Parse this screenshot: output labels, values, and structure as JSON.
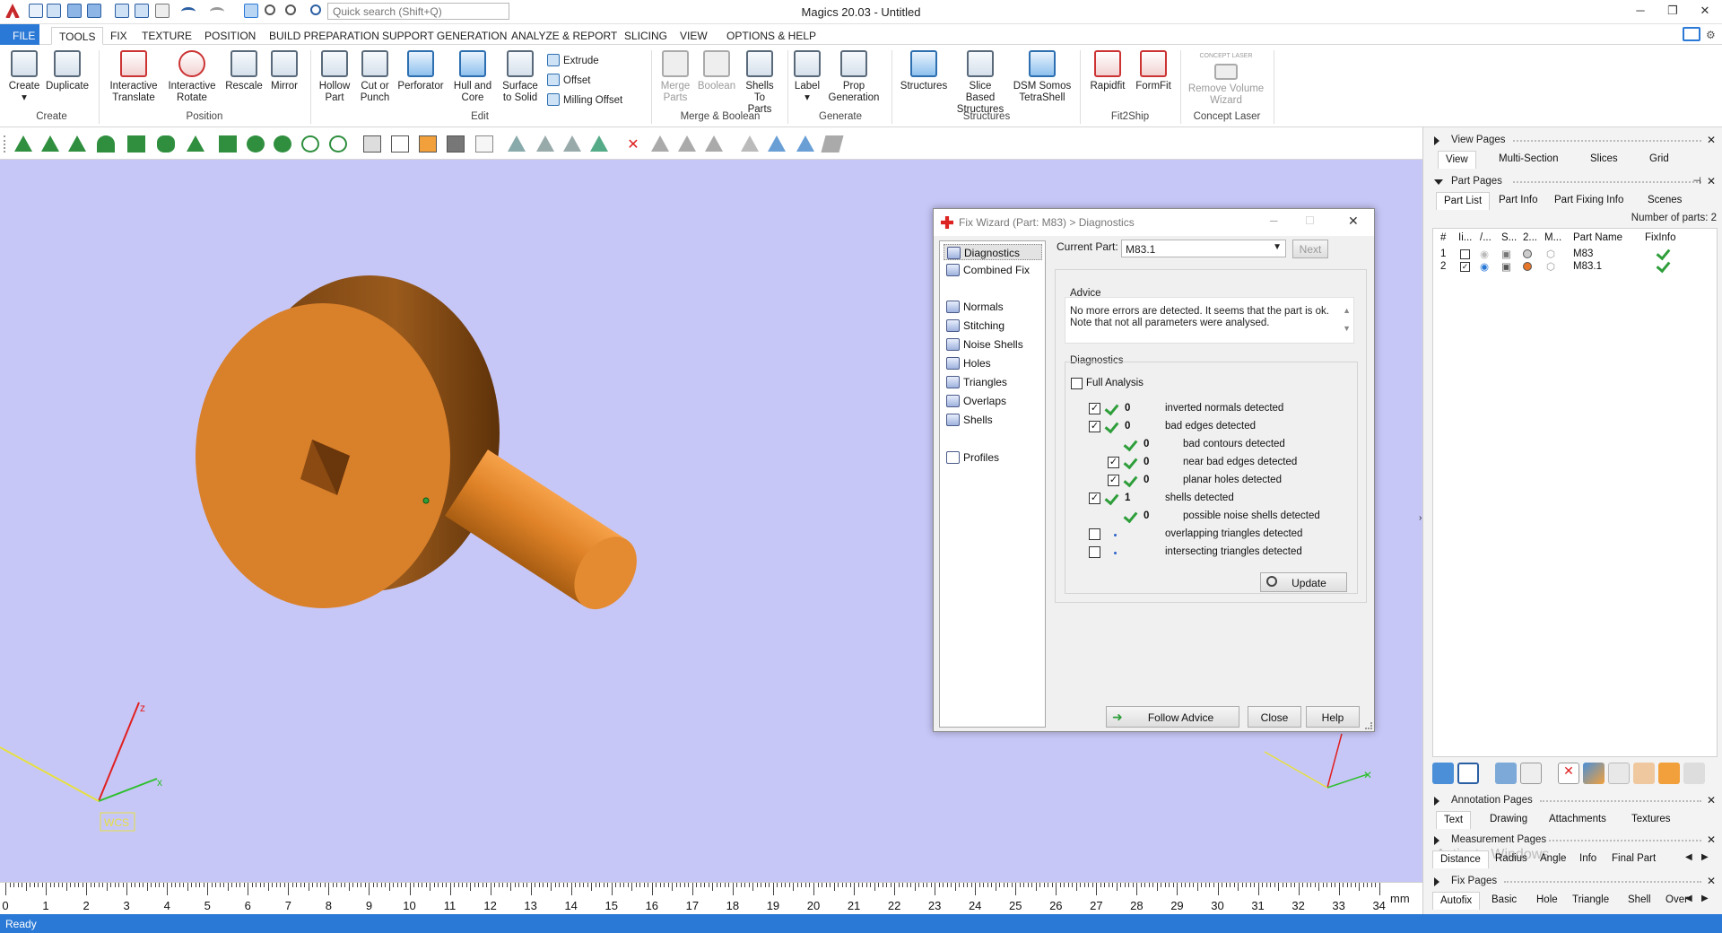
{
  "window": {
    "title": "Magics 20.03 - Untitled",
    "search_placeholder": "Quick search (Shift+Q)"
  },
  "menu": {
    "tabs": [
      "FILE",
      "TOOLS",
      "FIX",
      "TEXTURE",
      "POSITION",
      "BUILD PREPARATION",
      "SUPPORT GENERATION",
      "ANALYZE & REPORT",
      "SLICING",
      "VIEW",
      "OPTIONS & HELP"
    ]
  },
  "ribbon": {
    "create": {
      "create": "Create",
      "duplicate": "Duplicate",
      "group": "Create"
    },
    "position": {
      "interactive_translate": "Interactive Translate",
      "interactive_rotate": "Interactive Rotate",
      "rescale": "Rescale",
      "mirror": "Mirror",
      "group": "Position"
    },
    "edit": {
      "hollow": "Hollow Part",
      "cut_punch": "Cut or Punch",
      "perforator": "Perforator",
      "hull_core": "Hull and Core",
      "surface_solid": "Surface to Solid",
      "extrude": "Extrude",
      "offset": "Offset",
      "milling_offset": "Milling Offset",
      "group": "Edit"
    },
    "merge": {
      "merge_parts": "Merge Parts",
      "boolean": "Boolean",
      "shells_to_parts": "Shells To Parts",
      "group": "Merge & Boolean"
    },
    "generate": {
      "label": "Label",
      "prop_gen": "Prop Generation",
      "group": "Generate"
    },
    "structures": {
      "structures": "Structures",
      "slice_based": "Slice Based Structures",
      "dsm": "DSM Somos TetraShell",
      "group": "Structures"
    },
    "fit2ship": {
      "rapidfit": "Rapidfit",
      "formfit": "FormFit",
      "group": "Fit2Ship"
    },
    "concept": {
      "remove_volume": "Remove Volume Wizard",
      "group": "Concept Laser",
      "logo": "CONCEPT LASER"
    }
  },
  "viewport": {
    "wcs_label": "WCS",
    "axis_x": "x",
    "axis_z": "z"
  },
  "ruler": {
    "unit": "mm",
    "ticks": [
      "0",
      "1",
      "2",
      "3",
      "4",
      "5",
      "6",
      "7",
      "8",
      "9",
      "10",
      "11",
      "12",
      "13",
      "14",
      "15",
      "16",
      "17",
      "18",
      "19",
      "20",
      "21",
      "22",
      "23",
      "24",
      "25",
      "26",
      "27",
      "28",
      "29",
      "30",
      "31",
      "32",
      "33",
      "34"
    ]
  },
  "status": {
    "text": "Ready"
  },
  "dialog": {
    "title": "Fix Wizard (Part: M83) > Diagnostics",
    "nav": [
      "Diagnostics",
      "Combined Fix",
      "Normals",
      "Stitching",
      "Noise Shells",
      "Holes",
      "Triangles",
      "Overlaps",
      "Shells",
      "Profiles"
    ],
    "current_part_label": "Current Part:",
    "current_part_value": "M83.1",
    "next_label": "Next",
    "advice_label": "Advice",
    "advice_text": "No more errors are detected. It seems that the part is ok. Note that not all parameters were analysed.",
    "diagnostics_label": "Diagnostics",
    "full_analysis_label": "Full Analysis",
    "rows": [
      {
        "count": "0",
        "label": "inverted normals detected"
      },
      {
        "count": "0",
        "label": "bad edges detected"
      },
      {
        "count": "0",
        "label": "bad contours detected"
      },
      {
        "count": "0",
        "label": "near bad edges detected"
      },
      {
        "count": "0",
        "label": "planar holes detected"
      },
      {
        "count": "1",
        "label": "shells detected"
      },
      {
        "count": "0",
        "label": "possible noise shells detected"
      },
      {
        "count": "",
        "label": "overlapping triangles detected"
      },
      {
        "count": "",
        "label": "intersecting triangles detected"
      }
    ],
    "update_label": "Update",
    "follow_advice_label": "Follow Advice",
    "close_label": "Close",
    "help_label": "Help"
  },
  "right_panel": {
    "view_pages": {
      "label": "View Pages",
      "tabs": [
        "View",
        "Multi-Section",
        "Slices",
        "Grid"
      ]
    },
    "part_pages": {
      "label": "Part Pages",
      "tabs": [
        "Part List",
        "Part Info",
        "Part Fixing Info",
        "Scenes"
      ],
      "num_parts": "Number of parts: 2",
      "columns": [
        "#",
        "Ii...",
        "/...",
        "S...",
        "2...",
        "M...",
        "Part Name",
        "FixInfo"
      ],
      "rows": [
        {
          "num": "1",
          "name": "M83"
        },
        {
          "num": "2",
          "name": "M83.1"
        }
      ]
    },
    "annotation_pages": {
      "label": "Annotation Pages",
      "tabs": [
        "Text",
        "Drawing",
        "Attachments",
        "Textures"
      ]
    },
    "measurement_pages": {
      "label": "Measurement Pages",
      "tabs": [
        "Distance",
        "Radius",
        "Angle",
        "Info",
        "Final Part"
      ]
    },
    "fix_pages": {
      "label": "Fix Pages",
      "tabs": [
        "Autofix",
        "Basic",
        "Hole",
        "Triangle",
        "Shell",
        "Over"
      ]
    },
    "watermark": "Activate Windows"
  },
  "colors": {
    "accent": "#2b79d6",
    "viewport_bg": "#c7c7f7",
    "part": "#d9802a",
    "check": "#2e9e3a"
  }
}
